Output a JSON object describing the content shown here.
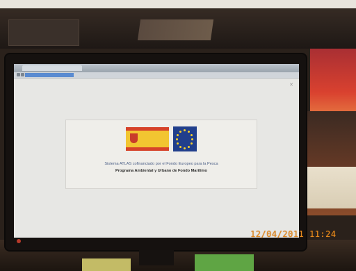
{
  "banner": {
    "line1": "Sistema ATLAS cofinanciado por el Fondo Europeo para la Pesca",
    "line2": "Programa Ambiental y Urbano de Fondo Marítimo"
  },
  "timestamp": "12/04/2011 11:24",
  "colors": {
    "eu_blue": "#213f8c",
    "spain_yellow": "#f2c531",
    "spain_red": "#d6422a",
    "timestamp_orange": "#e58a1e"
  },
  "icons": [
    "spain-government-logo-icon",
    "eu-flag-icon",
    "close-icon"
  ]
}
